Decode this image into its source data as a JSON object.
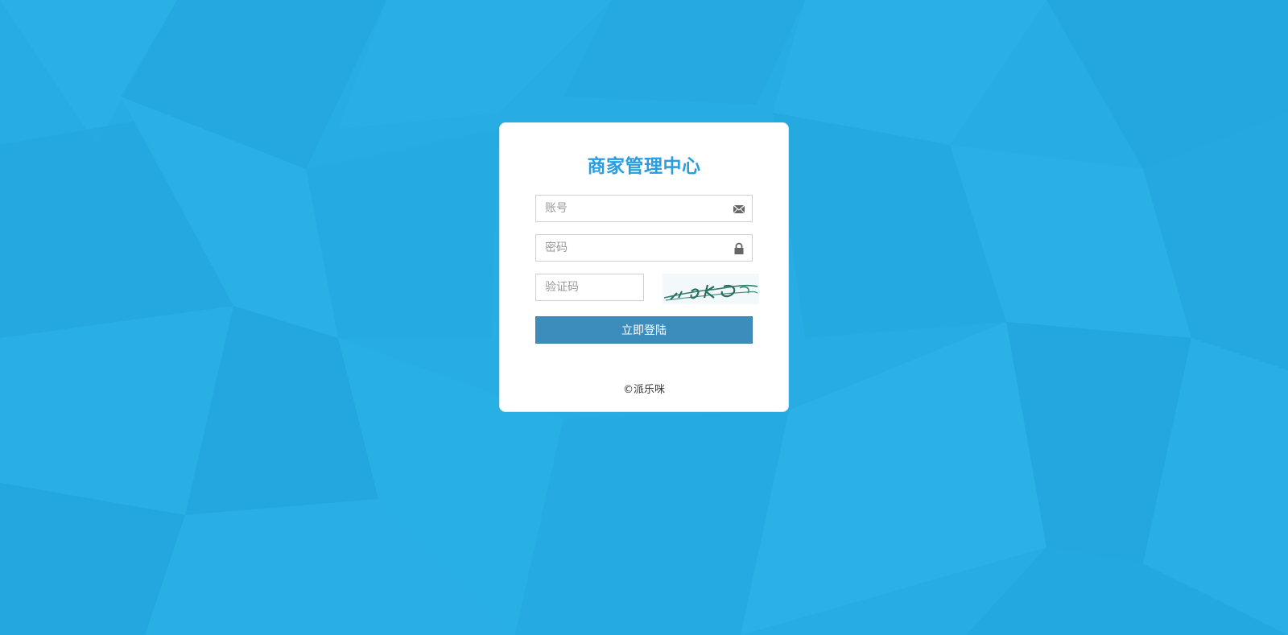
{
  "colors": {
    "background": "#27ade3",
    "title": "#2a9de0",
    "button": "#3c8dbc",
    "card": "#ffffff"
  },
  "login": {
    "title": "商家管理中心",
    "account": {
      "placeholder": "账号",
      "value": "",
      "icon": "envelope-icon"
    },
    "password": {
      "placeholder": "密码",
      "value": "",
      "icon": "lock-icon"
    },
    "captcha": {
      "placeholder": "验证码",
      "value": ""
    },
    "submit_label": "立即登陆",
    "footer": "©派乐咪"
  }
}
